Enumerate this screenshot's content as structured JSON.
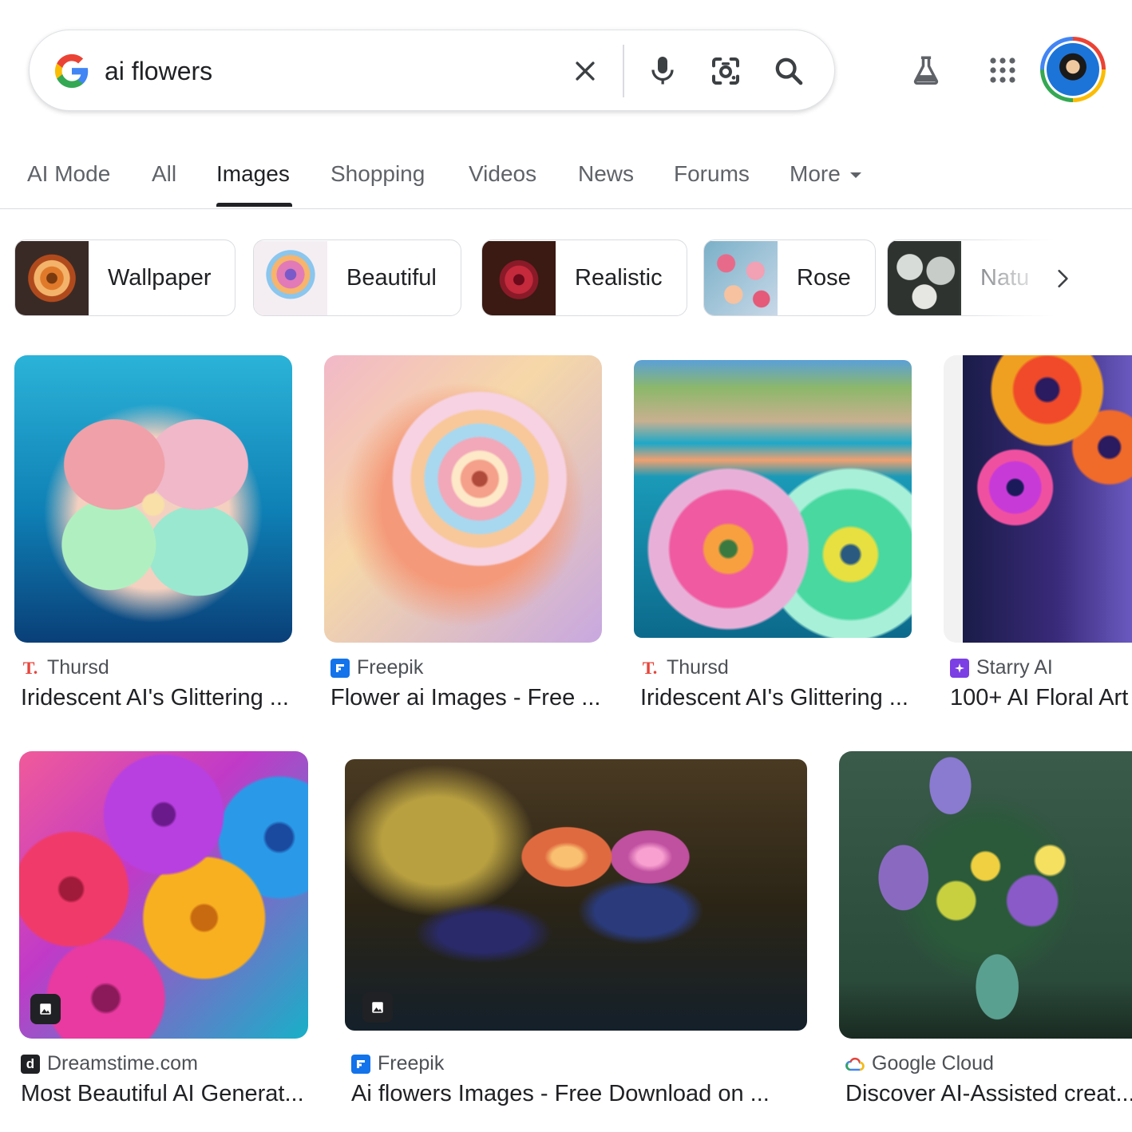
{
  "search": {
    "query": "ai flowers",
    "icons": [
      "google-g-icon",
      "clear-icon",
      "microphone-icon",
      "lens-icon",
      "search-icon"
    ]
  },
  "header_icons": [
    "labs-flask-icon",
    "apps-grid-icon",
    "account-avatar"
  ],
  "tabs": [
    {
      "label": "AI Mode"
    },
    {
      "label": "All"
    },
    {
      "label": "Images",
      "active": true
    },
    {
      "label": "Shopping"
    },
    {
      "label": "Videos"
    },
    {
      "label": "News"
    },
    {
      "label": "Forums"
    },
    {
      "label": "More"
    }
  ],
  "chips": [
    {
      "label": "Wallpaper"
    },
    {
      "label": "Beautiful"
    },
    {
      "label": "Realistic"
    },
    {
      "label": "Rose"
    },
    {
      "label": "Natu"
    }
  ],
  "results": [
    {
      "source": "Thursd",
      "title": "Iridescent AI's Glittering ..."
    },
    {
      "source": "Freepik",
      "title": "Flower ai Images - Free ..."
    },
    {
      "source": "Thursd",
      "title": "Iridescent AI's Glittering ..."
    },
    {
      "source": "Starry AI",
      "title": "100+ AI Floral Art"
    },
    {
      "source": "Dreamstime.com",
      "title": "Most Beautiful AI Generat..."
    },
    {
      "source": "Freepik",
      "title": "Ai flowers Images - Free Download on ..."
    },
    {
      "source": "Google Cloud",
      "title": "Discover AI-Assisted creat..."
    }
  ],
  "colors": {
    "google_blue": "#4285f4",
    "google_red": "#ea4335",
    "google_yellow": "#fbbc05",
    "google_green": "#34a853",
    "thursd_red": "#e8443a",
    "freepik_blue": "#1273eb",
    "starry_purple": "#7b3fe4"
  }
}
